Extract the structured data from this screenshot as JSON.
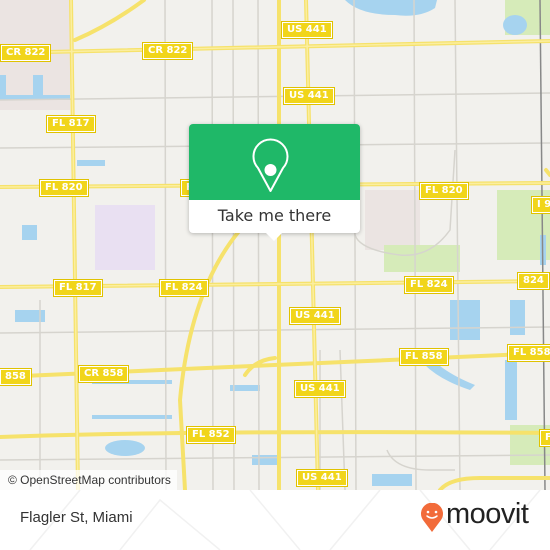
{
  "map": {
    "colors": {
      "background": "#f2f1ed",
      "road_major": "#f6e26b",
      "road_minor": "#d6d4ce",
      "water": "#a6d3ef",
      "park": "#d6ebb9",
      "residential": "#ebe4e2",
      "airport": "#e8def2"
    },
    "road_labels": [
      {
        "id": "cr822-west",
        "text": "CR 822"
      },
      {
        "id": "cr822-center",
        "text": "CR 822"
      },
      {
        "id": "us441-top",
        "text": "US 441"
      },
      {
        "id": "us441-second",
        "text": "US 441"
      },
      {
        "id": "fl817-north",
        "text": "FL 817"
      },
      {
        "id": "fl820-west",
        "text": "FL 820"
      },
      {
        "id": "fl820-center",
        "text": "FL 820"
      },
      {
        "id": "fl820-east",
        "text": "FL 820"
      },
      {
        "id": "i95-partial",
        "text": "I 9"
      },
      {
        "id": "fl817-south",
        "text": "FL 817"
      },
      {
        "id": "fl824-west",
        "text": "FL 824"
      },
      {
        "id": "fl824-center",
        "text": "FL 824"
      },
      {
        "id": "fl824-east",
        "text": "824"
      },
      {
        "id": "us441-mid",
        "text": "US 441"
      },
      {
        "id": "fl858-west",
        "text": "858"
      },
      {
        "id": "cr858",
        "text": "CR 858"
      },
      {
        "id": "fl858-center",
        "text": "FL 858"
      },
      {
        "id": "fl858-east",
        "text": "FL 858"
      },
      {
        "id": "us441-lower",
        "text": "US 441"
      },
      {
        "id": "fl852",
        "text": "FL 852"
      },
      {
        "id": "us441-bottom",
        "text": "US 441"
      },
      {
        "id": "fl852-east-partial",
        "text": "F"
      }
    ],
    "attribution": "© OpenStreetMap contributors"
  },
  "popup": {
    "icon": "map-pin-icon",
    "action_label": "Take me there",
    "accent_color": "#1fb868"
  },
  "footer": {
    "place_name": "Flagler St, Miami",
    "brand": {
      "name": "moovit",
      "icon": "moovit-smile-pin-icon",
      "color": "#f26b3a"
    }
  }
}
